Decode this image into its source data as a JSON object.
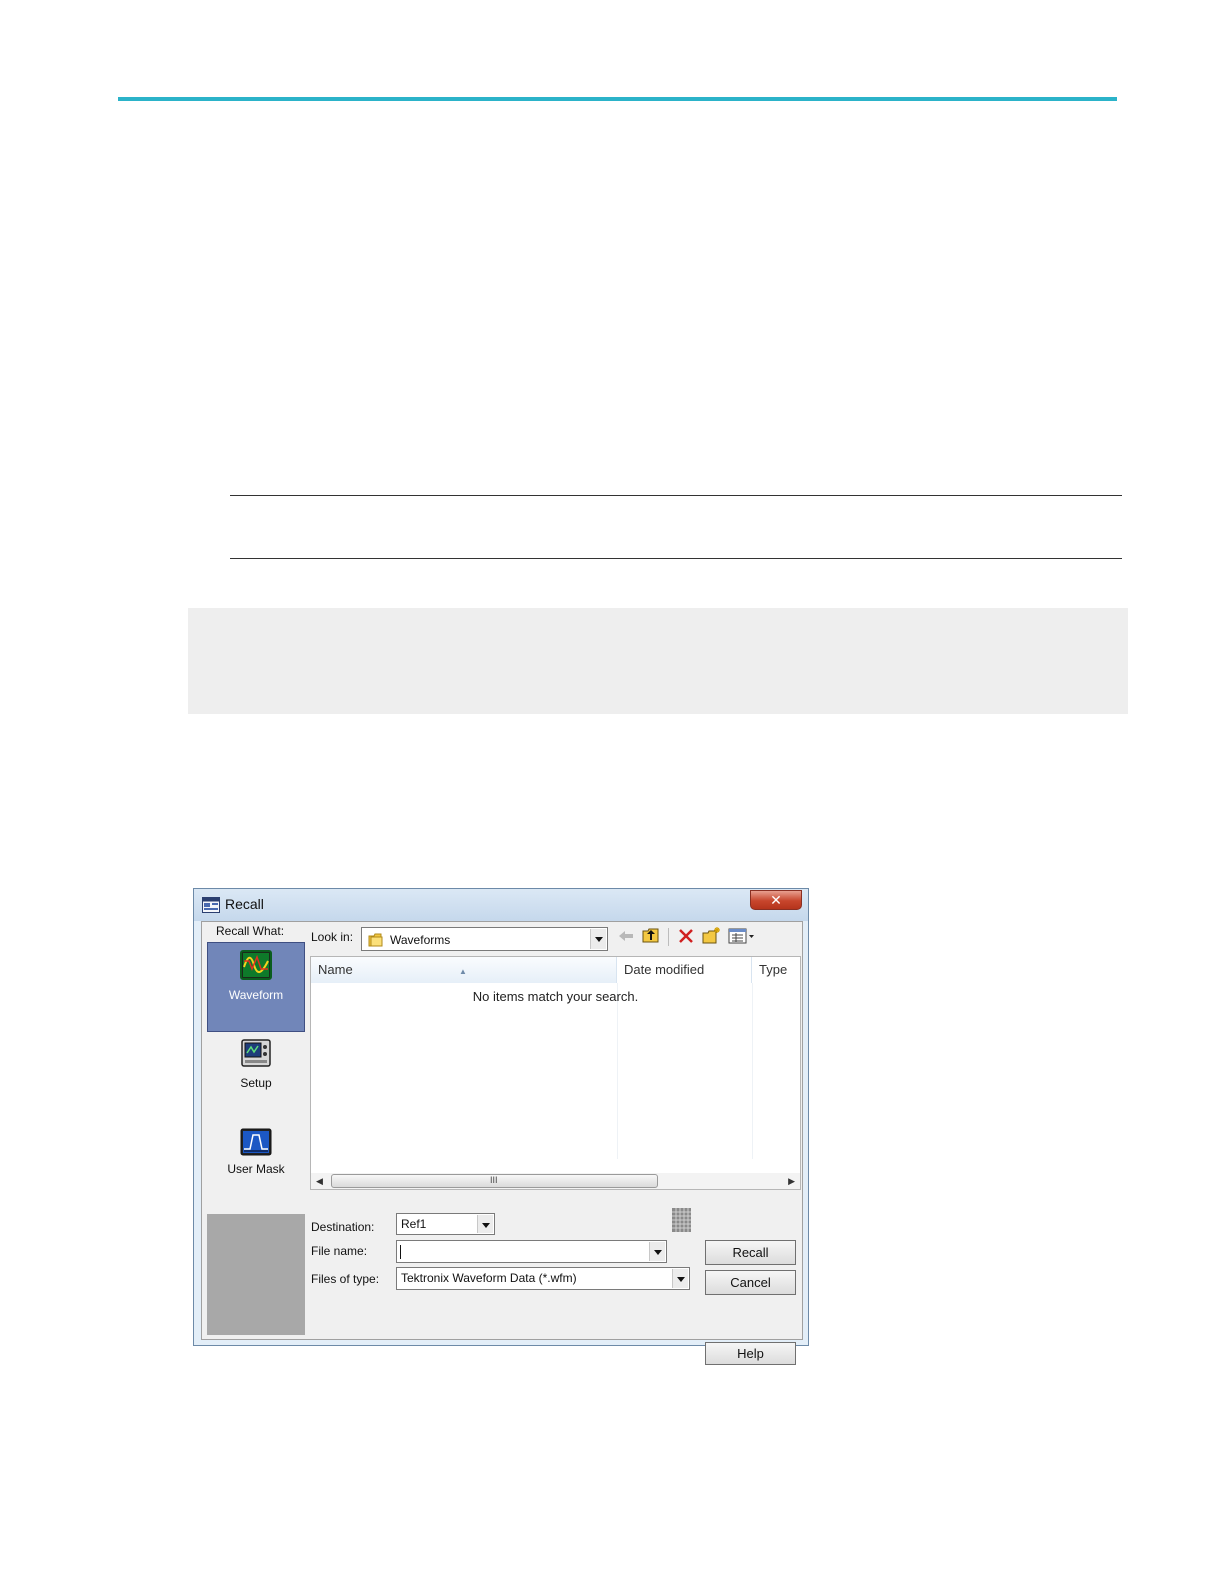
{
  "dialog": {
    "title": "Recall",
    "close_label": "✕"
  },
  "recall_what": {
    "label": "Recall What:",
    "options": [
      {
        "label": "Waveform",
        "selected": true
      },
      {
        "label": "Setup",
        "selected": false
      },
      {
        "label": "User Mask",
        "selected": false
      }
    ]
  },
  "look_in": {
    "label": "Look in:",
    "value": "Waveforms"
  },
  "toolbar_icons": [
    "back-arrow-icon",
    "up-folder-icon",
    "delete-icon",
    "new-folder-icon",
    "view-menu-icon"
  ],
  "file_list": {
    "columns": [
      "Name",
      "Date modified",
      "Type"
    ],
    "empty_message": "No items match your search.",
    "scroll_thumb": "III"
  },
  "destination": {
    "label": "Destination:",
    "value": "Ref1"
  },
  "file_name": {
    "label": "File name:",
    "value": ""
  },
  "files_of_type": {
    "label": "Files of type:",
    "value": "Tektronix Waveform Data (*.wfm)"
  },
  "buttons": {
    "recall": "Recall",
    "cancel": "Cancel",
    "help": "Help"
  },
  "colors": {
    "page_rule": "#2bb3c9",
    "selected_option": "#7186b9"
  }
}
